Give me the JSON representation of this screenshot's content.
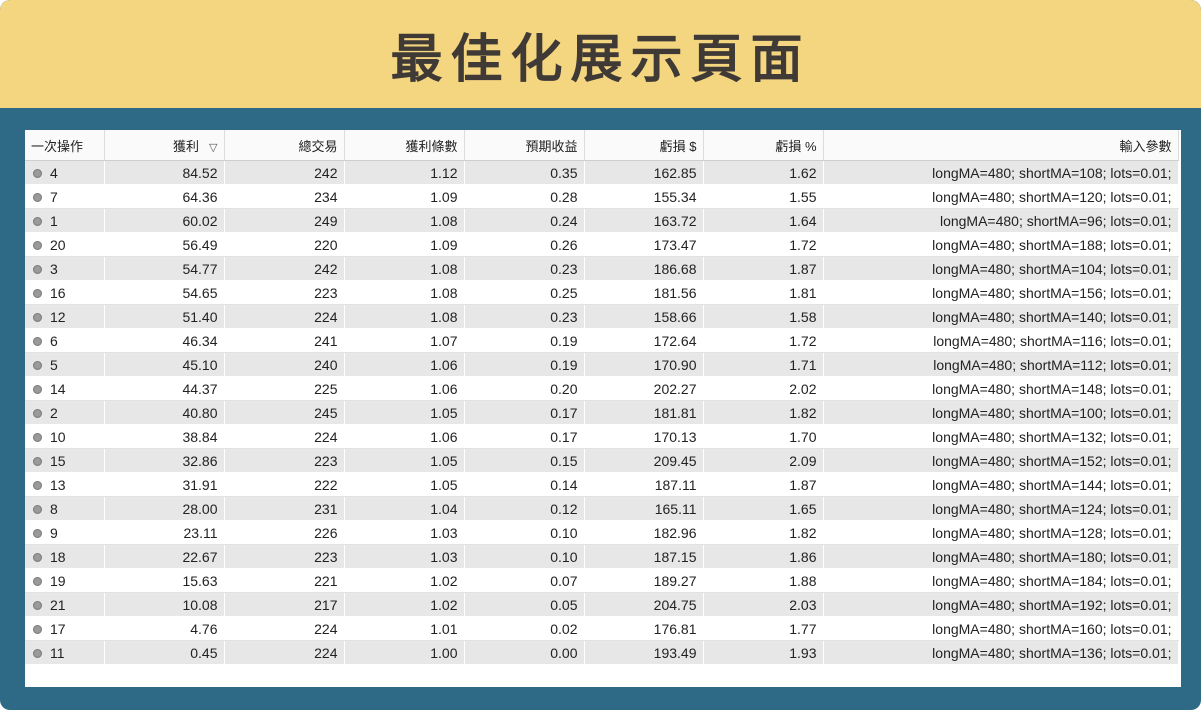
{
  "banner": {
    "title": "最佳化展示頁面"
  },
  "table": {
    "headers": [
      "一次操作",
      "獲利",
      "總交易",
      "獲利條數",
      "預期收益",
      "虧損 $",
      "虧損 %",
      "輸入參數"
    ],
    "sort_icon": "▽",
    "rows": [
      [
        "4",
        "84.52",
        "242",
        "1.12",
        "0.35",
        "162.85",
        "1.62",
        "longMA=480; shortMA=108; lots=0.01;"
      ],
      [
        "7",
        "64.36",
        "234",
        "1.09",
        "0.28",
        "155.34",
        "1.55",
        "longMA=480; shortMA=120; lots=0.01;"
      ],
      [
        "1",
        "60.02",
        "249",
        "1.08",
        "0.24",
        "163.72",
        "1.64",
        "longMA=480; shortMA=96; lots=0.01;"
      ],
      [
        "20",
        "56.49",
        "220",
        "1.09",
        "0.26",
        "173.47",
        "1.72",
        "longMA=480; shortMA=188; lots=0.01;"
      ],
      [
        "3",
        "54.77",
        "242",
        "1.08",
        "0.23",
        "186.68",
        "1.87",
        "longMA=480; shortMA=104; lots=0.01;"
      ],
      [
        "16",
        "54.65",
        "223",
        "1.08",
        "0.25",
        "181.56",
        "1.81",
        "longMA=480; shortMA=156; lots=0.01;"
      ],
      [
        "12",
        "51.40",
        "224",
        "1.08",
        "0.23",
        "158.66",
        "1.58",
        "longMA=480; shortMA=140; lots=0.01;"
      ],
      [
        "6",
        "46.34",
        "241",
        "1.07",
        "0.19",
        "172.64",
        "1.72",
        "longMA=480; shortMA=116; lots=0.01;"
      ],
      [
        "5",
        "45.10",
        "240",
        "1.06",
        "0.19",
        "170.90",
        "1.71",
        "longMA=480; shortMA=112; lots=0.01;"
      ],
      [
        "14",
        "44.37",
        "225",
        "1.06",
        "0.20",
        "202.27",
        "2.02",
        "longMA=480; shortMA=148; lots=0.01;"
      ],
      [
        "2",
        "40.80",
        "245",
        "1.05",
        "0.17",
        "181.81",
        "1.82",
        "longMA=480; shortMA=100; lots=0.01;"
      ],
      [
        "10",
        "38.84",
        "224",
        "1.06",
        "0.17",
        "170.13",
        "1.70",
        "longMA=480; shortMA=132; lots=0.01;"
      ],
      [
        "15",
        "32.86",
        "223",
        "1.05",
        "0.15",
        "209.45",
        "2.09",
        "longMA=480; shortMA=152; lots=0.01;"
      ],
      [
        "13",
        "31.91",
        "222",
        "1.05",
        "0.14",
        "187.11",
        "1.87",
        "longMA=480; shortMA=144; lots=0.01;"
      ],
      [
        "8",
        "28.00",
        "231",
        "1.04",
        "0.12",
        "165.11",
        "1.65",
        "longMA=480; shortMA=124; lots=0.01;"
      ],
      [
        "9",
        "23.11",
        "226",
        "1.03",
        "0.10",
        "182.96",
        "1.82",
        "longMA=480; shortMA=128; lots=0.01;"
      ],
      [
        "18",
        "22.67",
        "223",
        "1.03",
        "0.10",
        "187.15",
        "1.86",
        "longMA=480; shortMA=180; lots=0.01;"
      ],
      [
        "19",
        "15.63",
        "221",
        "1.02",
        "0.07",
        "189.27",
        "1.88",
        "longMA=480; shortMA=184; lots=0.01;"
      ],
      [
        "21",
        "10.08",
        "217",
        "1.02",
        "0.05",
        "204.75",
        "2.03",
        "longMA=480; shortMA=192; lots=0.01;"
      ],
      [
        "17",
        "4.76",
        "224",
        "1.01",
        "0.02",
        "176.81",
        "1.77",
        "longMA=480; shortMA=160; lots=0.01;"
      ],
      [
        "11",
        "0.45",
        "224",
        "1.00",
        "0.00",
        "193.49",
        "1.93",
        "longMA=480; shortMA=136; lots=0.01;"
      ]
    ]
  },
  "colors": {
    "banner_bg": "#f5d680",
    "frame_bg": "#2e6985",
    "row_alt": "#e7e7e7"
  },
  "icons": {
    "row_marker": "bullet-icon",
    "sort": "sort-desc-icon"
  }
}
